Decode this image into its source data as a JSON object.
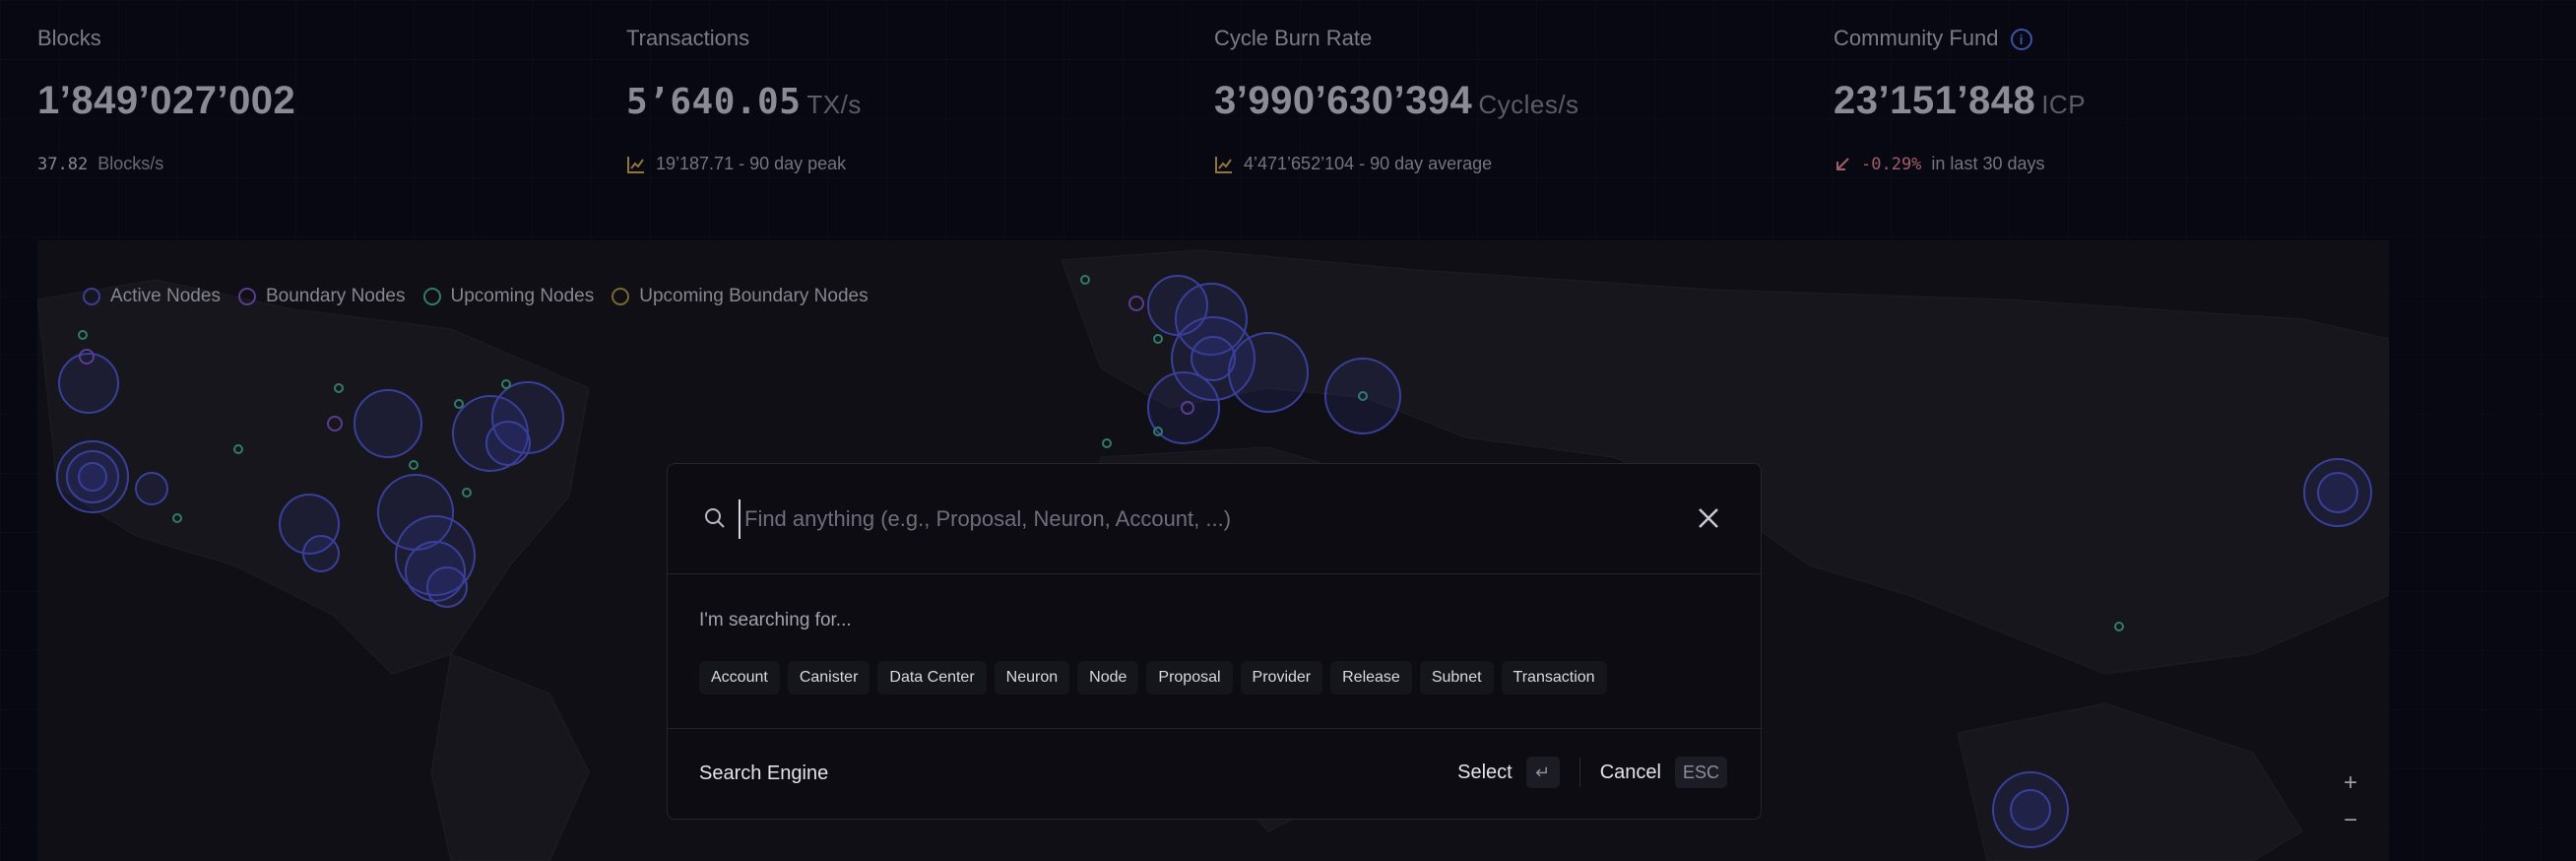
{
  "stats": [
    {
      "title": "Blocks",
      "value": "1’849’027’002",
      "unit": "",
      "sub_value": "37.82",
      "sub_label": "Blocks/s"
    },
    {
      "title": "Transactions",
      "value": "5’640.05",
      "unit": "TX/s",
      "sub_value": "19’187.71 - 90 day peak",
      "sub_label": ""
    },
    {
      "title": "Cycle Burn Rate",
      "value": "3’990’630’394",
      "unit": "Cycles/s",
      "sub_value": "4’471’652’104 - 90 day average",
      "sub_label": ""
    },
    {
      "title": "Community Fund",
      "value": "23’151’848",
      "unit": "ICP",
      "sub_value": "-0.29%",
      "sub_label": "in last 30 days"
    }
  ],
  "map": {
    "legend": [
      {
        "label": "Active Nodes",
        "color": "#4b54c8"
      },
      {
        "label": "Boundary Nodes",
        "color": "#7a4fbf"
      },
      {
        "label": "Upcoming Nodes",
        "color": "#3fa38a"
      },
      {
        "label": "Upcoming Boundary Nodes",
        "color": "#a08a3c"
      }
    ],
    "zoom_in": "+",
    "zoom_out": "−"
  },
  "search": {
    "placeholder": "Find anything (e.g., Proposal, Neuron, Account, ...)",
    "value": "",
    "searching_label": "I'm searching for...",
    "categories": [
      "Account",
      "Canister",
      "Data Center",
      "Neuron",
      "Node",
      "Proposal",
      "Provider",
      "Release",
      "Subnet",
      "Transaction"
    ],
    "footer_title": "Search Engine",
    "select_label": "Select",
    "select_key": "↵",
    "cancel_label": "Cancel",
    "cancel_key": "ESC"
  },
  "colors": {
    "accent": "#4f6fd6",
    "negative": "#d97b8a",
    "node": "#4b54c8"
  }
}
